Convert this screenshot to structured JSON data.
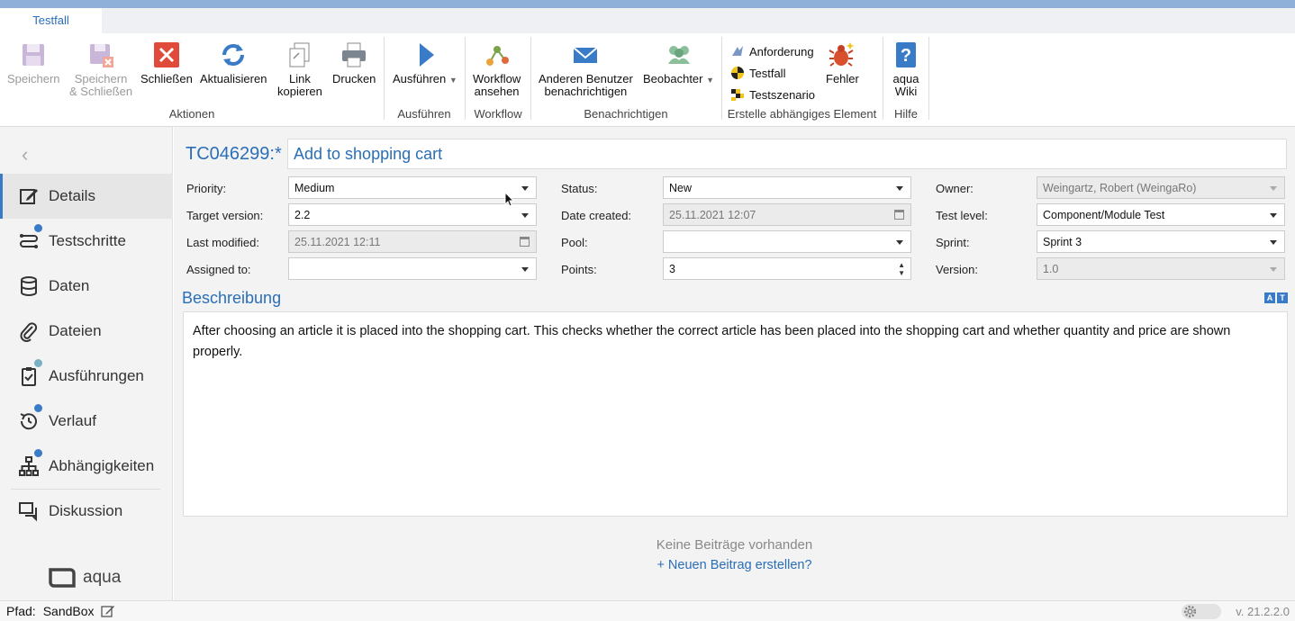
{
  "tab": {
    "label": "Testfall"
  },
  "ribbon": {
    "speichern": "Speichern",
    "speichern_schliessen_1": "Speichern",
    "speichern_schliessen_2": "& Schließen",
    "schliessen": "Schließen",
    "aktualisieren": "Aktualisieren",
    "link_kopieren_1": "Link",
    "link_kopieren_2": "kopieren",
    "drucken": "Drucken",
    "ausfuehren": "Ausführen",
    "workflow_1": "Workflow",
    "workflow_2": "ansehen",
    "anderen_1": "Anderen Benutzer",
    "anderen_2": "benachrichtigen",
    "beobachter": "Beobachter",
    "anforderung": "Anforderung",
    "testfall": "Testfall",
    "testszenario": "Testszenario",
    "fehler": "Fehler",
    "aqua_wiki_1": "aqua",
    "aqua_wiki_2": "Wiki",
    "groups": {
      "aktionen": "Aktionen",
      "ausfuehren": "Ausführen",
      "workflow": "Workflow",
      "benachrichtigen": "Benachrichtigen",
      "erstelle": "Erstelle abhängiges Element",
      "hilfe": "Hilfe"
    }
  },
  "sidebar": {
    "items": [
      {
        "label": "Details"
      },
      {
        "label": "Testschritte"
      },
      {
        "label": "Daten"
      },
      {
        "label": "Dateien"
      },
      {
        "label": "Ausführungen"
      },
      {
        "label": "Verlauf"
      },
      {
        "label": "Abhängigkeiten"
      },
      {
        "label": "Diskussion"
      }
    ],
    "brand": "aqua"
  },
  "item": {
    "id": "TC046299:*",
    "title": "Add to shopping cart"
  },
  "fields": {
    "priority_label": "Priority:",
    "priority_value": "Medium",
    "target_label": "Target version:",
    "target_value": "2.2",
    "modified_label": "Last modified:",
    "modified_value": "25.11.2021 12:11",
    "assigned_label": "Assigned to:",
    "assigned_value": "",
    "status_label": "Status:",
    "status_value": "New",
    "created_label": "Date created:",
    "created_value": "25.11.2021 12:07",
    "pool_label": "Pool:",
    "pool_value": "",
    "points_label": "Points:",
    "points_value": "3",
    "owner_label": "Owner:",
    "owner_value": "Weingartz, Robert (WeingaRo)",
    "testlevel_label": "Test level:",
    "testlevel_value": "Component/Module Test",
    "sprint_label": "Sprint:",
    "sprint_value": "Sprint 3",
    "version_label": "Version:",
    "version_value": "1.0"
  },
  "description": {
    "title": "Beschreibung",
    "text": "After choosing an article it is placed into the shopping cart. This checks whether the correct article has been placed into the shopping cart and whether quantity and price are shown properly."
  },
  "discussion": {
    "empty": "Keine Beiträge vorhanden",
    "new": "+  Neuen Beitrag erstellen?"
  },
  "status": {
    "path_label": "Pfad:",
    "path_value": "SandBox",
    "version": "v. 21.2.2.0"
  }
}
